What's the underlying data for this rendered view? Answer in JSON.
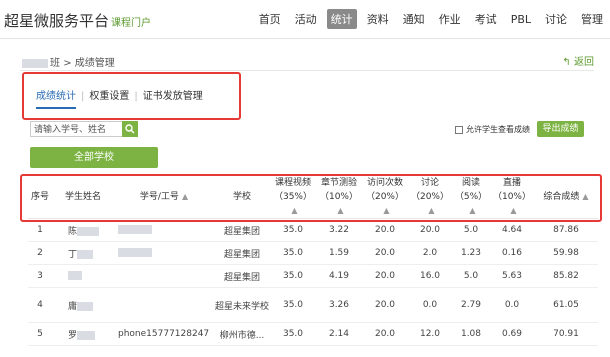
{
  "header": {
    "brand": "超星微服务平台",
    "brand_sub": "课程门户",
    "nav": [
      "首页",
      "活动",
      "统计",
      "资料",
      "通知",
      "作业",
      "考试",
      "PBL",
      "讨论",
      "管理"
    ],
    "active_nav": "统计"
  },
  "breadcrumb": {
    "class_suffix": "班",
    "separator": ">",
    "current": "成绩管理"
  },
  "back_label": "返回",
  "tabs": [
    "成绩统计",
    "权重设置",
    "证书发放管理"
  ],
  "active_tab": "成绩统计",
  "search": {
    "placeholder": "请输入学号、姓名"
  },
  "checkbox_label": "允许学生查看成绩",
  "export_label": "导出成绩",
  "all_school_label": "全部学校",
  "table": {
    "headers": [
      "序号",
      "学生姓名",
      "学号/工号",
      "学校",
      "课程视频（35%）",
      "章节测验（10%）",
      "访问次数（20%）",
      "讨论（20%）",
      "阅读（5%）",
      "直播（10%）",
      "综合成绩"
    ],
    "rows": [
      {
        "no": "1",
        "name": "陈",
        "id": "",
        "school": "超星集团",
        "video": "35.0",
        "quiz": "3.22",
        "visits": "20.0",
        "discuss": "20.0",
        "read": "5.0",
        "live": "4.64",
        "total": "87.86"
      },
      {
        "no": "2",
        "name": "丁",
        "id": "",
        "school": "超星集团",
        "video": "35.0",
        "quiz": "1.59",
        "visits": "20.0",
        "discuss": "2.0",
        "read": "1.23",
        "live": "0.16",
        "total": "59.98"
      },
      {
        "no": "3",
        "name": "",
        "id": "",
        "school": "超星集团",
        "video": "35.0",
        "quiz": "4.19",
        "visits": "20.0",
        "discuss": "16.0",
        "read": "5.0",
        "live": "5.63",
        "total": "85.82"
      },
      {
        "no": "4",
        "name": "庸",
        "id": "",
        "school": "超星未来学校",
        "video": "35.0",
        "quiz": "3.26",
        "visits": "20.0",
        "discuss": "0.0",
        "read": "2.79",
        "live": "0.0",
        "total": "61.05"
      },
      {
        "no": "5",
        "name": "罗",
        "id": "phone15777128247",
        "school": "柳州市德...",
        "video": "35.0",
        "quiz": "2.14",
        "visits": "20.0",
        "discuss": "12.0",
        "read": "1.08",
        "live": "0.69",
        "total": "70.91"
      }
    ]
  }
}
